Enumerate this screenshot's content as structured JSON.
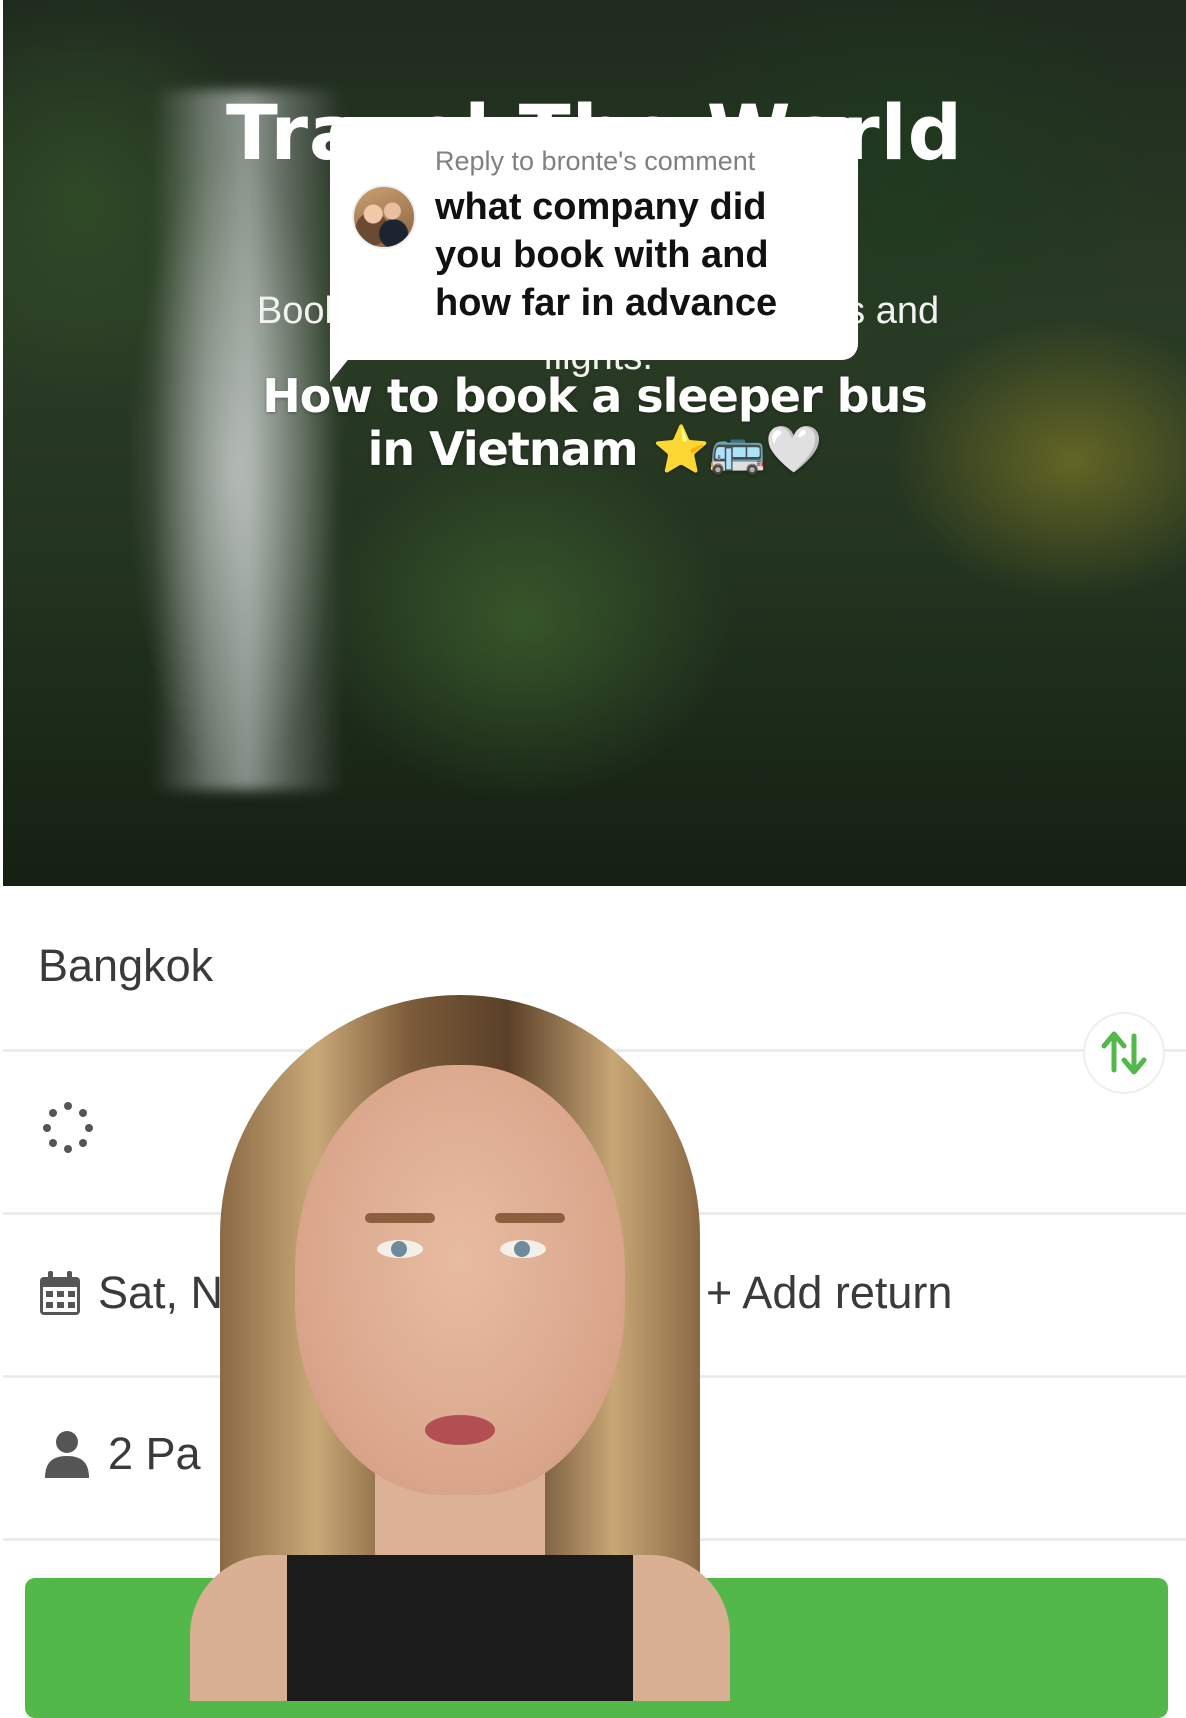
{
  "hero": {
    "title": "Travel The World",
    "subtitle": "Book trains, buses, ferries, transfers and flights.",
    "caption_line1": "How to book a sleeper bus",
    "caption_line2": "in Vietnam ⭐🚌🤍"
  },
  "reply": {
    "label": "Reply to bronte's comment",
    "text": "what company did you book with and how far in advance"
  },
  "form": {
    "from_value": "Bangkok",
    "depart_date": "Sat, N",
    "add_return_label": "+ Add return",
    "passengers": "2 Pa"
  },
  "colors": {
    "accent": "#52b84a",
    "swap_up": "#52b84a",
    "swap_down": "#52b84a"
  },
  "icons": [
    "swap-arrows-icon",
    "loading-spinner-icon",
    "calendar-icon",
    "person-icon"
  ]
}
